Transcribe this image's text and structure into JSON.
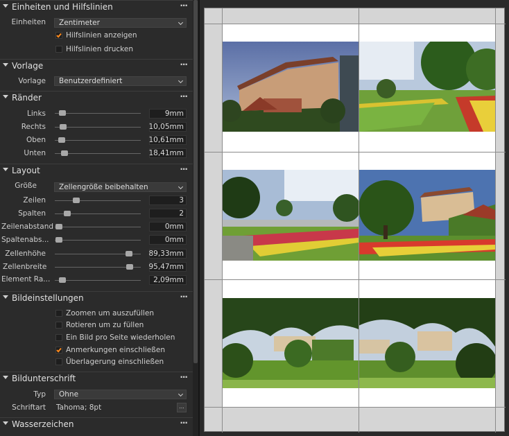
{
  "sections": {
    "units": {
      "title": "Einheiten und Hilfslinien",
      "units_label": "Einheiten",
      "units_value": "Zentimeter",
      "show_guides": "Hilfslinien anzeigen",
      "print_guides": "Hilfslinien drucken"
    },
    "template": {
      "title": "Vorlage",
      "label": "Vorlage",
      "value": "Benutzerdefiniert"
    },
    "margins": {
      "title": "Ränder",
      "rows": [
        {
          "label": "Links",
          "value": "9mm"
        },
        {
          "label": "Rechts",
          "value": "10,05mm"
        },
        {
          "label": "Oben",
          "value": "10,61mm"
        },
        {
          "label": "Unten",
          "value": "18,41mm"
        }
      ]
    },
    "layout": {
      "title": "Layout",
      "size_label": "Größe",
      "size_value": "Zellengröße beibehalten",
      "rows": [
        {
          "label": "Zeilen",
          "value": "3"
        },
        {
          "label": "Spalten",
          "value": "2"
        },
        {
          "label": "Zeilenabstand",
          "value": "0mm"
        },
        {
          "label": "Spaltenabs...",
          "value": "0mm"
        },
        {
          "label": "Zellenhöhe",
          "value": "89,33mm"
        },
        {
          "label": "Zellenbreite",
          "value": "95,47mm"
        },
        {
          "label": "Element Ra...",
          "value": "2,09mm"
        }
      ]
    },
    "image": {
      "title": "Bildeinstellungen",
      "options": [
        {
          "label": "Zoomen um auszufüllen",
          "checked": false
        },
        {
          "label": "Rotieren um zu füllen",
          "checked": false
        },
        {
          "label": "Ein Bild pro Seite wiederholen",
          "checked": false
        },
        {
          "label": "Anmerkungen einschließen",
          "checked": true
        },
        {
          "label": "Überlagerung einschließen",
          "checked": false
        }
      ]
    },
    "caption": {
      "title": "Bildunterschrift",
      "type_label": "Typ",
      "type_value": "Ohne",
      "font_label": "Schriftart",
      "font_value": "Tahoma; 8pt",
      "font_button": "..."
    },
    "watermark": {
      "title": "Wasserzeichen"
    }
  },
  "menu_icon": "more-dots-icon",
  "menu_glyph": "···",
  "colors": {
    "panel_bg": "#2b2b2b",
    "accent_check": "#ff8a1c",
    "page_margin": "#d5d5d5",
    "cell_bg": "#ffffff"
  }
}
